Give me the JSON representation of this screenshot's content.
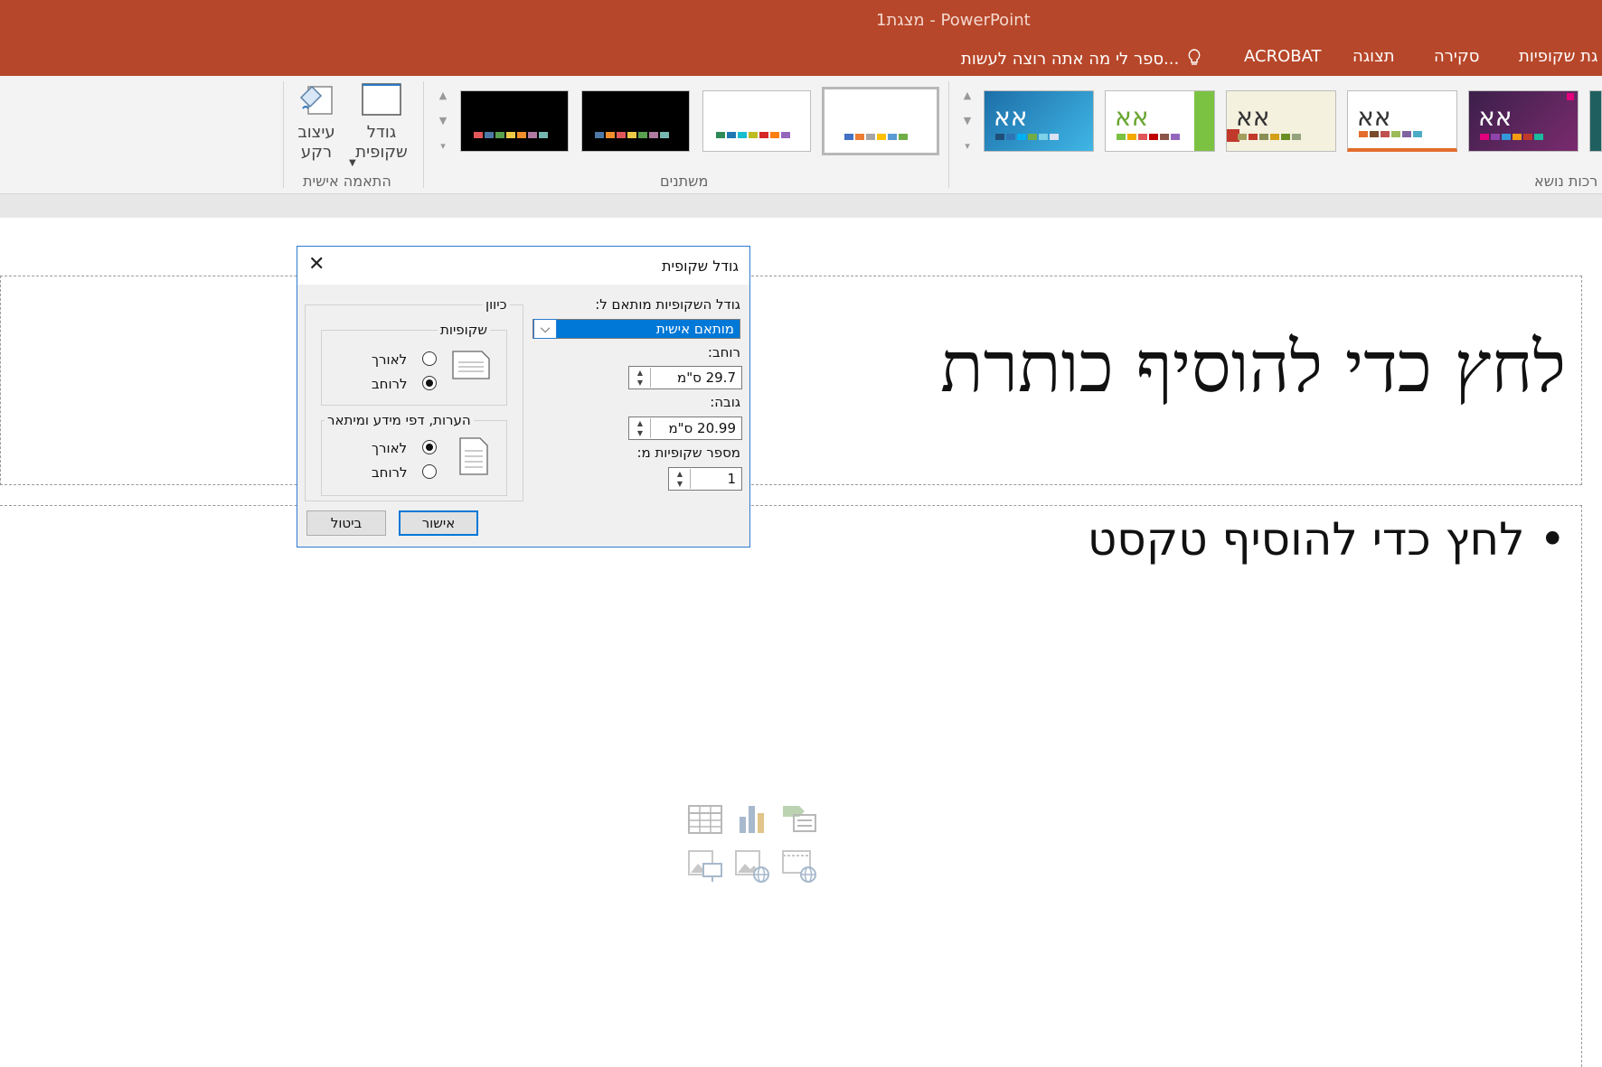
{
  "window": {
    "title": "מצגת1 - PowerPoint"
  },
  "ribbon": {
    "tabs": [
      "גת שקופיות",
      "סקירה",
      "תצוגה",
      "ACROBAT"
    ],
    "tell_me": "ספר לי מה אתה רוצה לעשות...",
    "groups": {
      "themes_label": "רכות נושא",
      "variants_label": "משתנים",
      "customize_label": "התאמה אישית"
    },
    "customize": {
      "slide_size_label": "גודל שקופית",
      "format_background_label": "עיצוב רקע"
    },
    "theme_sample_text": "אא"
  },
  "slide": {
    "title_placeholder": "לחץ כדי להוסיף כותרת",
    "body_placeholder": "• לחץ כדי להוסיף טקסט"
  },
  "dialog": {
    "title": "גודל שקופית",
    "size_for_label": "גודל השקופיות מותאם ל:",
    "size_for_value": "מותאם אישית",
    "width_label": "רוחב:",
    "width_value": "29.7 ס\"מ",
    "height_label": "גובה:",
    "height_value": "20.99 ס\"מ",
    "number_from_label": "מספר שקופיות מ:",
    "number_from_value": "1",
    "orientation_label": "כיוון",
    "slides_group_label": "שקופיות",
    "slides_portrait": "לאורך",
    "slides_landscape": "לרוחב",
    "notes_group_label": "הערות, דפי מידע ומיתאר",
    "notes_portrait": "לאורך",
    "notes_landscape": "לרוחב",
    "ok_label": "אישור",
    "cancel_label": "ביטול"
  },
  "colors": {
    "accent": "#b7472a",
    "selection": "#0078d7"
  }
}
